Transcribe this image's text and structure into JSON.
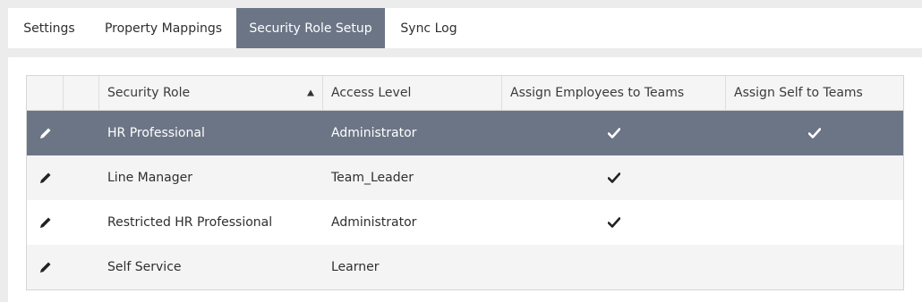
{
  "tabs": [
    {
      "label": "Settings",
      "active": false
    },
    {
      "label": "Property Mappings",
      "active": false
    },
    {
      "label": "Security Role Setup",
      "active": true
    },
    {
      "label": "Sync Log",
      "active": false
    }
  ],
  "grid": {
    "columns": {
      "security_role": "Security Role",
      "access_level": "Access Level",
      "assign_employees": "Assign Employees to Teams",
      "assign_self": "Assign Self to Teams"
    },
    "sort": {
      "column": "security_role",
      "direction": "ascending",
      "icon": "sort-ascending-icon"
    },
    "rows": [
      {
        "role": "HR Professional",
        "access": "Administrator",
        "assign_employees": true,
        "assign_self": true,
        "selected": true
      },
      {
        "role": "Line Manager",
        "access": "Team_Leader",
        "assign_employees": true,
        "assign_self": false,
        "selected": false
      },
      {
        "role": "Restricted HR Professional",
        "access": "Administrator",
        "assign_employees": true,
        "assign_self": false,
        "selected": false
      },
      {
        "role": "Self Service",
        "access": "Learner",
        "assign_employees": false,
        "assign_self": false,
        "selected": false
      }
    ]
  },
  "icons": {
    "edit": "pencil-icon",
    "check": "check-icon"
  },
  "colors": {
    "accent": "#6b7586",
    "background": "#ececec",
    "alt_row": "#f4f4f4"
  }
}
